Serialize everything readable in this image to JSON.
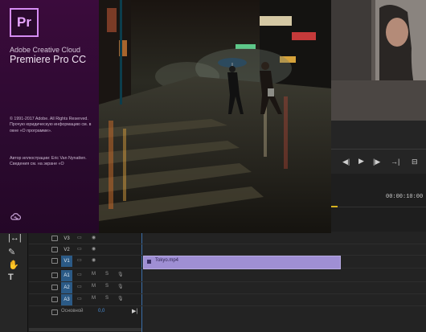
{
  "splash": {
    "logo_text": "Pr",
    "brand_line1": "Adobe Creative Cloud",
    "brand_line2": "Premiere Pro CC",
    "copyright": "© 1991-2017 Adobe. All Rights Reserved. Прочую юридическую информацию см. в окне «О программе».",
    "credits": "Автор иллюстрации: Eric Van Nynatten. Сведения см. на экране «О"
  },
  "program_monitor": {
    "timecode": "00:00:10:00",
    "transport_icons": [
      "step-back-icon",
      "play-icon",
      "step-forward-icon",
      "export-frame-icon"
    ]
  },
  "tools": [
    "ripple-edit-icon",
    "pen-icon",
    "hand-icon",
    "type-icon"
  ],
  "tracks": {
    "video": [
      {
        "label": "V3",
        "active": false
      },
      {
        "label": "V2",
        "active": false
      },
      {
        "label": "V1",
        "active": true
      }
    ],
    "audio": [
      {
        "label": "A1",
        "m": "M",
        "s": "S"
      },
      {
        "label": "A2",
        "m": "M",
        "s": "S"
      },
      {
        "label": "A3",
        "m": "M",
        "s": "S"
      }
    ],
    "master_label": "Основной",
    "master_value": "0,0"
  },
  "clip": {
    "name": "Tokyo.mp4"
  },
  "colors": {
    "accent": "#2b5a86",
    "clip": "#9f8fd4",
    "logo": "#d58cf3"
  }
}
